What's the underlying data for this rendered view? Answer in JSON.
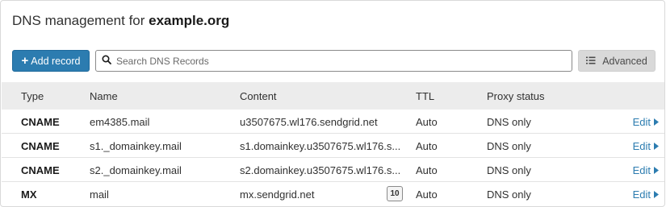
{
  "header": {
    "title_prefix": "DNS management for",
    "domain": "example.org"
  },
  "toolbar": {
    "add_label": "Add record",
    "search_placeholder": "Search DNS Records",
    "advanced_label": "Advanced"
  },
  "table": {
    "columns": [
      "Type",
      "Name",
      "Content",
      "TTL",
      "Proxy status"
    ],
    "edit_label": "Edit",
    "rows": [
      {
        "type": "CNAME",
        "name": "em4385.mail",
        "content": "u3507675.wl176.sendgrid.net",
        "priority": "",
        "ttl": "Auto",
        "proxy": "DNS only"
      },
      {
        "type": "CNAME",
        "name": "s1._domainkey.mail",
        "content": "s1.domainkey.u3507675.wl176.s...",
        "priority": "",
        "ttl": "Auto",
        "proxy": "DNS only"
      },
      {
        "type": "CNAME",
        "name": "s2._domainkey.mail",
        "content": "s2.domainkey.u3507675.wl176.s...",
        "priority": "",
        "ttl": "Auto",
        "proxy": "DNS only"
      },
      {
        "type": "MX",
        "name": "mail",
        "content": "mx.sendgrid.net",
        "priority": "10",
        "ttl": "Auto",
        "proxy": "DNS only"
      }
    ]
  },
  "colors": {
    "accent": "#2c7cb0",
    "header_bg": "#ececec"
  }
}
